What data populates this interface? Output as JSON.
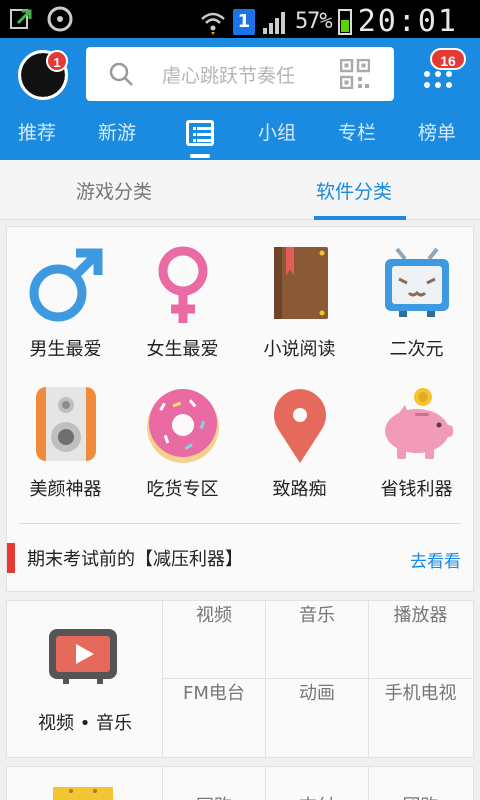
{
  "status_bar": {
    "sim_label": "1",
    "battery_percent": "57%",
    "time": "20:01"
  },
  "header": {
    "avatar_badge": "1",
    "search_placeholder": "虐心跳跃节奏任",
    "message_badge": "16",
    "nav_items": [
      "推荐",
      "新游",
      "小组",
      "专栏",
      "榜单"
    ],
    "active_nav_icon": "list-icon"
  },
  "sub_tabs": {
    "items": [
      "游戏分类",
      "软件分类"
    ],
    "active_index": 1
  },
  "categories": [
    {
      "label": "男生最爱",
      "icon": "male-symbol-icon"
    },
    {
      "label": "女生最爱",
      "icon": "female-symbol-icon"
    },
    {
      "label": "小说阅读",
      "icon": "book-icon"
    },
    {
      "label": "二次元",
      "icon": "tv-mascot-icon"
    },
    {
      "label": "美颜神器",
      "icon": "speaker-icon"
    },
    {
      "label": "吃货专区",
      "icon": "donut-icon"
    },
    {
      "label": "致路痴",
      "icon": "map-pin-icon"
    },
    {
      "label": "省钱利器",
      "icon": "piggy-bank-icon"
    }
  ],
  "promo": {
    "text": "期末考试前的【减压利器】",
    "link": "去看看"
  },
  "video_section": {
    "title": "视频 • 音乐",
    "items": [
      "视频",
      "音乐",
      "播放器",
      "FM电台",
      "动画",
      "手机电视"
    ]
  },
  "next_section": {
    "items": [
      "网购",
      "支付",
      "团购"
    ]
  },
  "colors": {
    "brand_blue": "#1a8be0",
    "badge_red": "#e53935",
    "male_blue": "#3d9ae0",
    "female_pink": "#ea6aa3"
  }
}
